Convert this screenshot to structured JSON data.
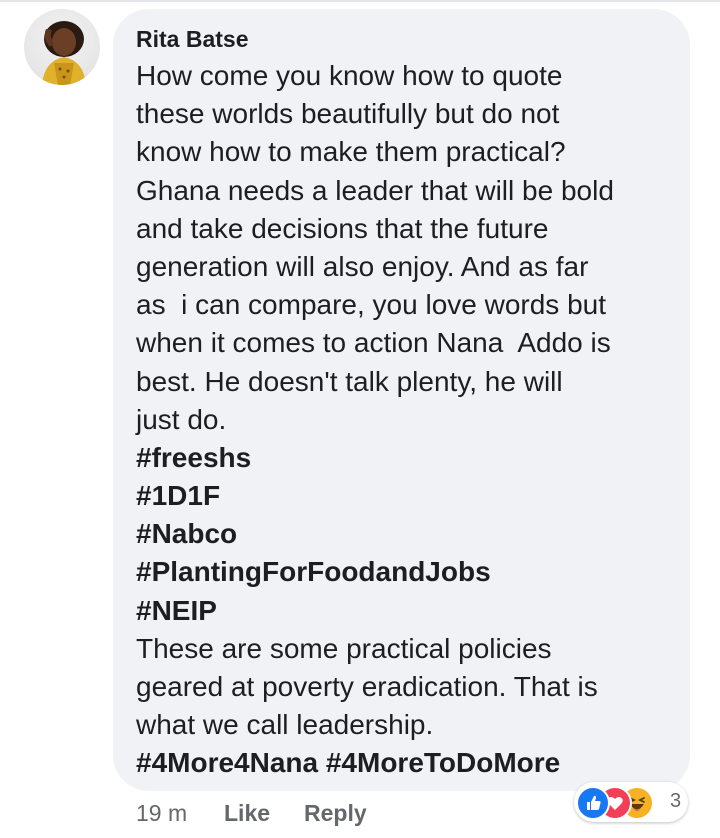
{
  "comment": {
    "author": "Rita Batse",
    "lines": [
      "How come you know how to quote",
      "these worlds beautifully but do not",
      "know how to make them practical?",
      "Ghana needs a leader that will be bold",
      "and take decisions that the future",
      "generation will also enjoy. And as far",
      "as  i can compare, you love words but",
      "when it comes to action Nana  Addo is",
      "best. He doesn't talk plenty, he will",
      "just do."
    ],
    "hashtags": [
      "#freeshs",
      "#1D1F",
      "#Nabco",
      "#PlantingForFoodandJobs",
      "#NEIP"
    ],
    "closing_lines": [
      "These are some practical policies",
      "geared at poverty eradication. That is",
      "what we call leadership."
    ],
    "final_tags": "#4More4Nana #4MoreToDoMore"
  },
  "actions": {
    "time": "19 m",
    "like_label": "Like",
    "reply_label": "Reply"
  },
  "reactions": {
    "icons": [
      "like-reaction",
      "love-reaction",
      "haha-reaction"
    ],
    "count": "3"
  },
  "colors": {
    "bubble": "#f0f2f5",
    "text": "#1c1e21",
    "secondary": "#65676b",
    "like_blue": "#1877f2",
    "love_red": "#f33e58",
    "haha_yellow": "#f7b125"
  }
}
